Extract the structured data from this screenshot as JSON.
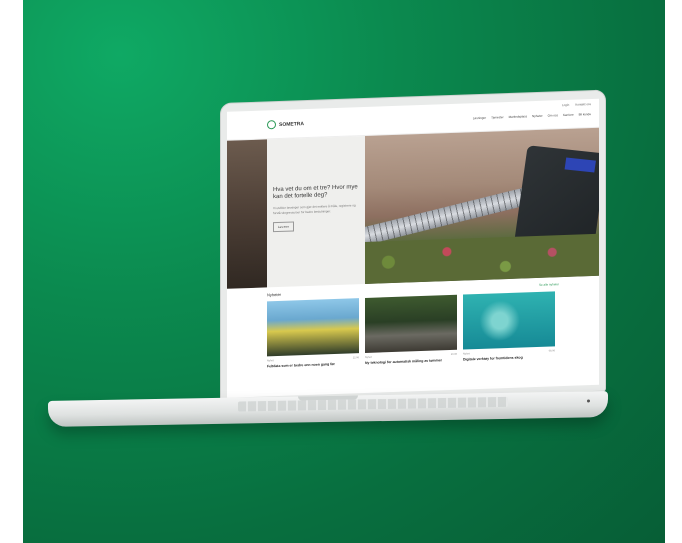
{
  "site": {
    "logo_text": "SOMETRA",
    "utility_links": [
      "Login",
      "Kontakt oss"
    ],
    "nav_items": [
      "Løsninger",
      "Tjenester",
      "Markedsplass",
      "Nyheter",
      "Om oss",
      "Karriere",
      "Bli kunde"
    ],
    "hero": {
      "title": "Hva vet du om et tre? Hvor mye kan det fortelle deg?",
      "text": "Vi utvikler løsninger som gjør det enklere å måle, registrere og forstå skogressurser for bedre beslutninger.",
      "button_label": "Les mer"
    },
    "news": {
      "heading": "Nyheter",
      "all_link": "Se alle nyheter",
      "cards": [
        {
          "category": "Nyhet",
          "date": "12.06",
          "title": "Feltdata som er bedre enn noen gang før"
        },
        {
          "category": "Nyhet",
          "date": "10.06",
          "title": "Ny teknologi for automatisk måling av tømmer"
        },
        {
          "category": "Nyhet",
          "date": "08.06",
          "title": "Digitale verktøy for fremtidens skog"
        }
      ]
    }
  },
  "icons": {
    "logo": "leaf-circle-icon"
  },
  "colors": {
    "background_green": "#0b8a4f",
    "brand_green": "#2c9a58"
  }
}
